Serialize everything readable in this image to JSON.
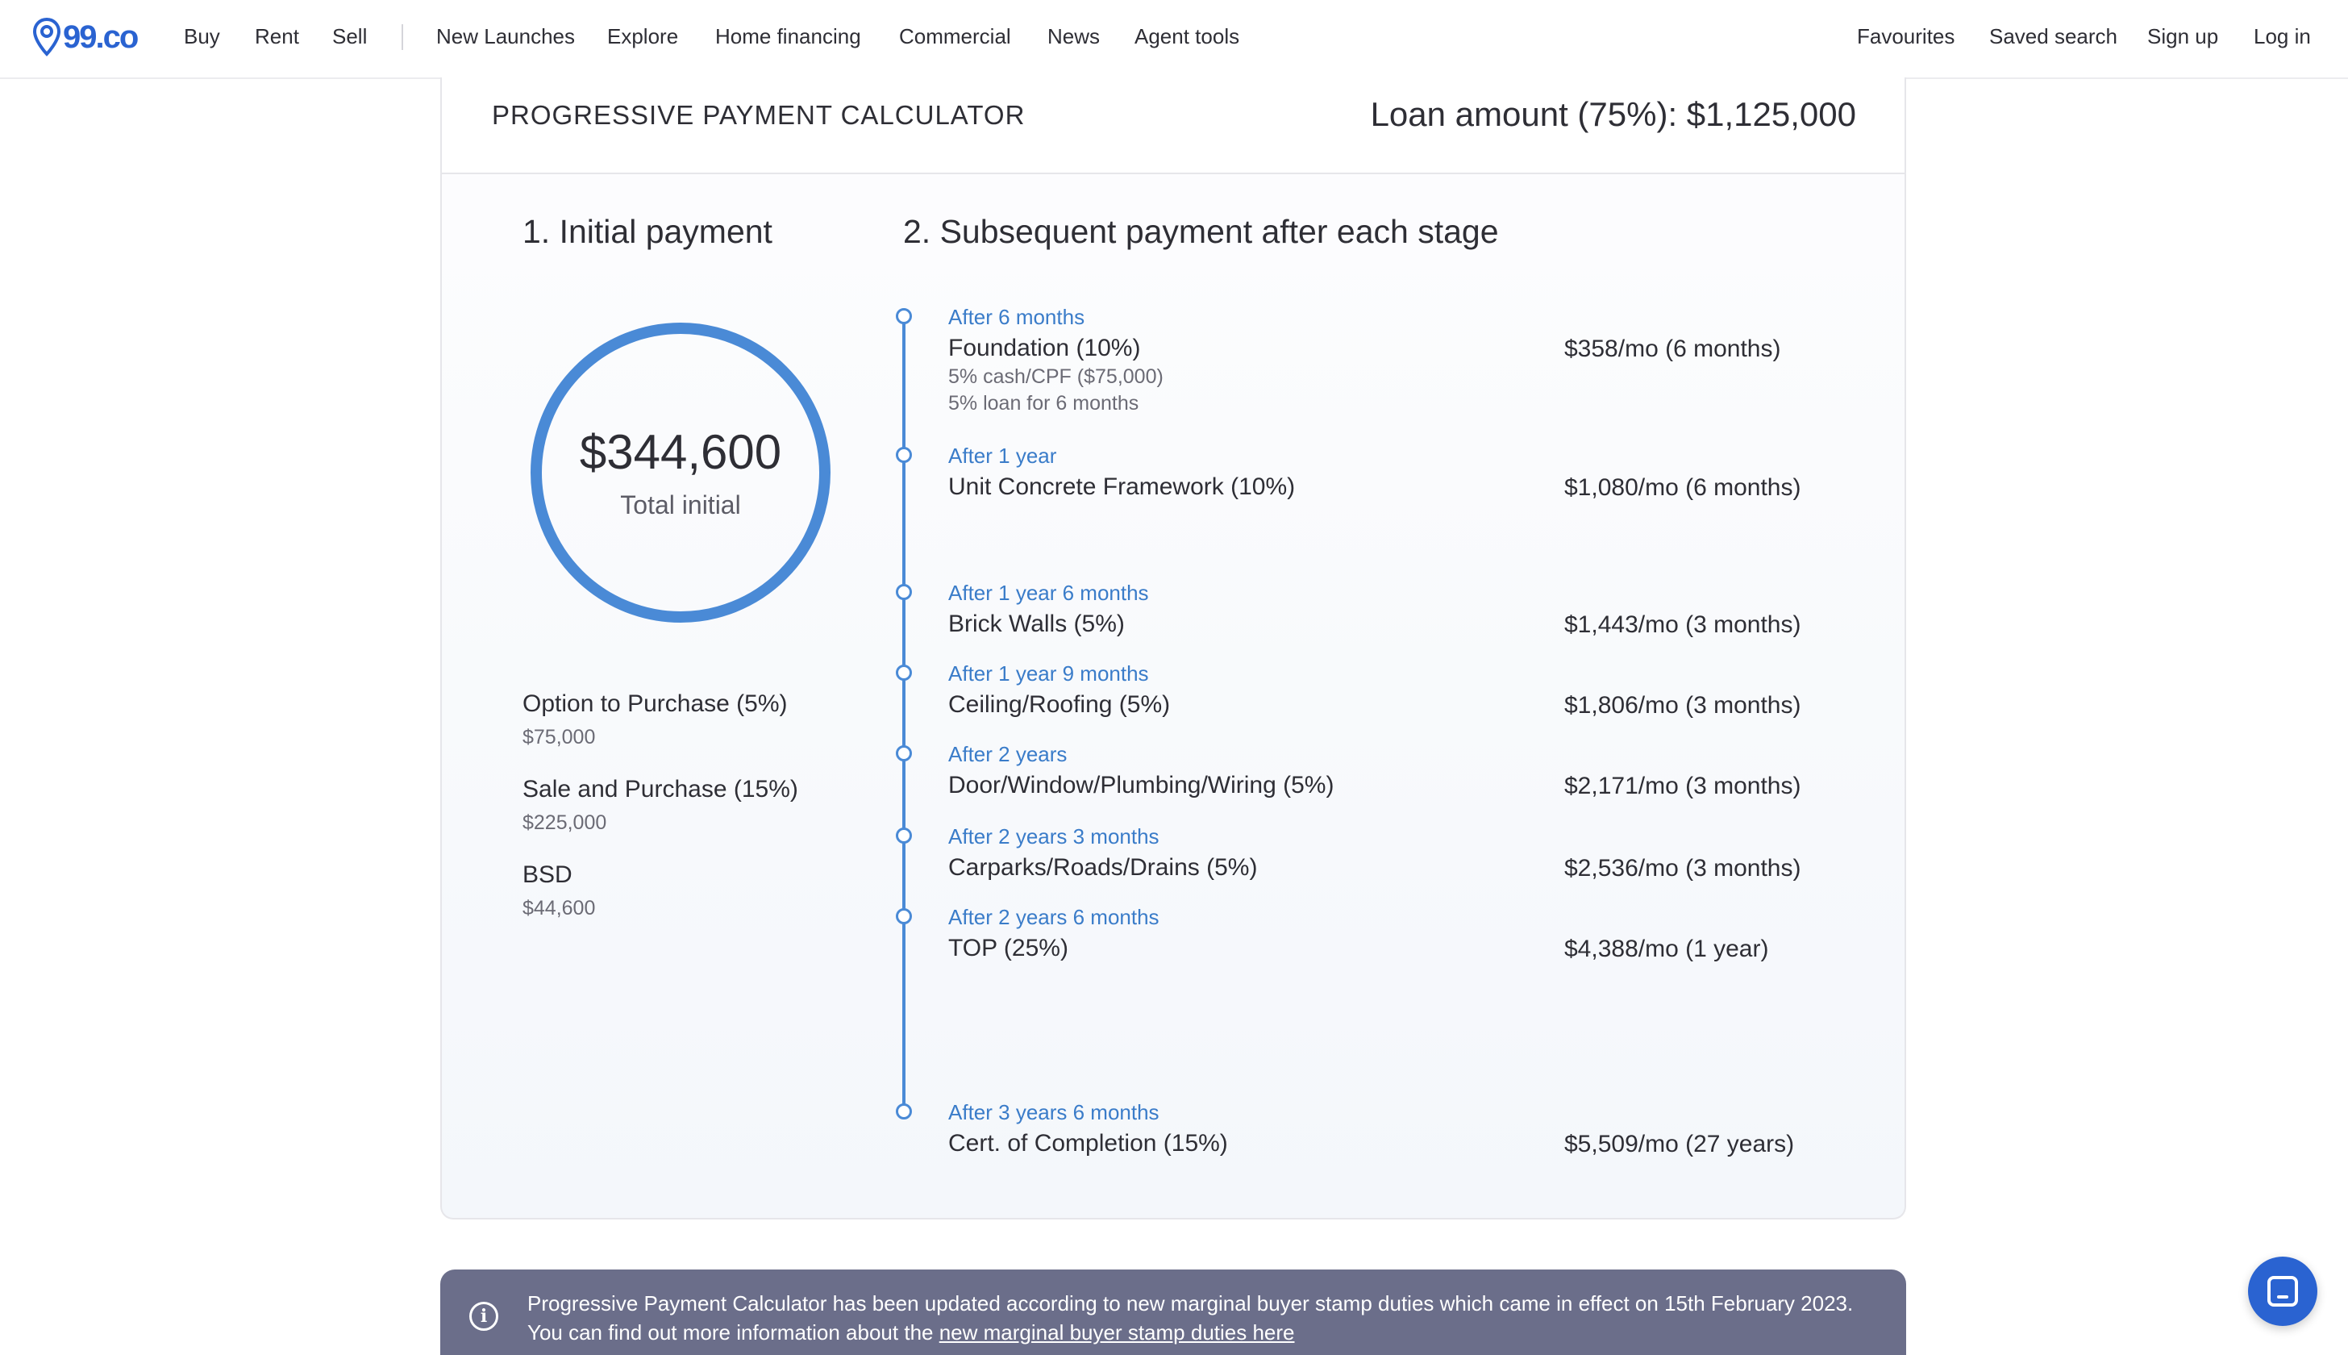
{
  "brand": {
    "name": "99.co",
    "accent": "#2a63d1"
  },
  "nav": {
    "left": [
      "Buy",
      "Rent",
      "Sell"
    ],
    "main": [
      "New Launches",
      "Explore",
      "Home financing",
      "Commercial",
      "News",
      "Agent tools"
    ],
    "right": [
      "Favourites",
      "Saved search",
      "Sign up",
      "Log in"
    ]
  },
  "calculator": {
    "title": "PROGRESSIVE PAYMENT CALCULATOR",
    "loan_amount": "Loan amount (75%): $1,125,000",
    "initial": {
      "heading": "1. Initial payment",
      "total_amount": "$344,600",
      "total_label": "Total initial",
      "items": [
        {
          "label": "Option to Purchase (5%)",
          "value": "$75,000"
        },
        {
          "label": "Sale and Purchase (15%)",
          "value": "$225,000"
        },
        {
          "label": "BSD",
          "value": "$44,600"
        }
      ]
    },
    "subsequent": {
      "heading": "2. Subsequent payment after each stage",
      "stages": [
        {
          "when": "After 6 months",
          "name": "Foundation (10%)",
          "notes": [
            "5% cash/CPF ($75,000)",
            "5% loan for 6 months"
          ],
          "payment": "$358/mo (6 months)"
        },
        {
          "when": "After 1 year",
          "name": "Unit Concrete Framework (10%)",
          "notes": [],
          "payment": "$1,080/mo (6 months)"
        },
        {
          "when": "After 1 year 6 months",
          "name": "Brick Walls (5%)",
          "notes": [],
          "payment": "$1,443/mo (3 months)"
        },
        {
          "when": "After 1 year 9 months",
          "name": "Ceiling/Roofing (5%)",
          "notes": [],
          "payment": "$1,806/mo (3 months)"
        },
        {
          "when": "After 2 years",
          "name": "Door/Window/Plumbing/Wiring (5%)",
          "notes": [],
          "payment": "$2,171/mo (3 months)"
        },
        {
          "when": "After 2 years 3 months",
          "name": "Carparks/Roads/Drains (5%)",
          "notes": [],
          "payment": "$2,536/mo (3 months)"
        },
        {
          "when": "After 2 years 6 months",
          "name": "TOP (25%)",
          "notes": [],
          "payment": "$4,388/mo (1 year)"
        },
        {
          "when": "After 3 years 6 months",
          "name": "Cert. of Completion (15%)",
          "notes": [],
          "payment": "$5,509/mo (27 years)"
        }
      ]
    }
  },
  "banner": {
    "line1": "Progressive Payment Calculator has been updated according to new marginal buyer stamp duties which came in effect on 15th February 2023.",
    "line2_prefix": "You can find out more information about the ",
    "link_text": "new marginal buyer stamp duties here"
  },
  "icons": {
    "logo": "location-pin-icon",
    "info": "info-circle-icon",
    "chat": "chat-icon"
  }
}
